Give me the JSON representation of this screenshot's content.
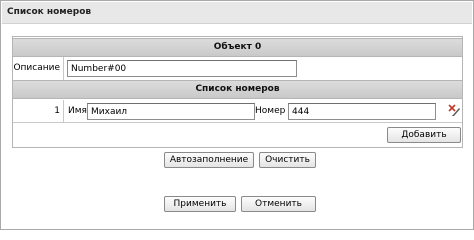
{
  "window": {
    "title": "Список номеров"
  },
  "object_section": {
    "header": "Объект 0",
    "description_label": "Описание",
    "description_value": "Number#00"
  },
  "numbers_section": {
    "header": "Список номеров",
    "items": [
      {
        "index": "1",
        "name_label": "Имя",
        "name_value": "Михаил",
        "number_label": "Номер",
        "number_value": "444"
      }
    ],
    "add_label": "Добавить"
  },
  "actions": {
    "autofill_label": "Автозаполнение",
    "clear_label": "Очистить",
    "apply_label": "Применить",
    "cancel_label": "Отменить"
  },
  "icons": {
    "delete": "delete-pencil-icon"
  },
  "colors": {
    "header_bg": "#cfcfcf",
    "title_bg": "#e8e8e8",
    "delete_icon_accent": "#c0392b"
  }
}
